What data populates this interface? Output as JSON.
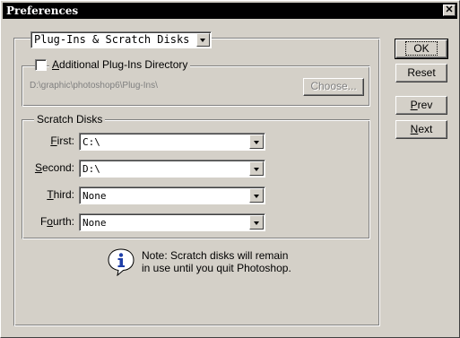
{
  "window": {
    "title": "Preferences",
    "close_glyph": "✕"
  },
  "section_select": {
    "value": "Plug-Ins & Scratch Disks"
  },
  "plugins": {
    "checkbox_label_accel": "A",
    "checkbox_label_rest": "dditional Plug-Ins Directory",
    "checked": false,
    "path": "D:\\graphic\\photoshop6\\Plug-Ins\\",
    "choose_label": "Choose..."
  },
  "scratch": {
    "legend": "Scratch Disks",
    "rows": [
      {
        "accel": "F",
        "rest": "irst:",
        "value": "C:\\"
      },
      {
        "accel": "S",
        "rest": "econd:",
        "value": "D:\\"
      },
      {
        "accel": "T",
        "rest": "hird:",
        "value": "None"
      },
      {
        "accel": "o",
        "pre": "F",
        "rest": "urth:",
        "value": "None"
      }
    ]
  },
  "note": {
    "icon": "info-icon",
    "line1": "Note: Scratch disks will remain",
    "line2": "in use until you quit Photoshop."
  },
  "buttons": {
    "ok": "OK",
    "reset": "Reset",
    "prev_accel": "P",
    "prev_rest": "rev",
    "next_accel": "N",
    "next_rest": "ext"
  },
  "colors": {
    "face": "#d4d0c8",
    "titlebar": "#000000",
    "info_icon": "#1f3fa8"
  }
}
